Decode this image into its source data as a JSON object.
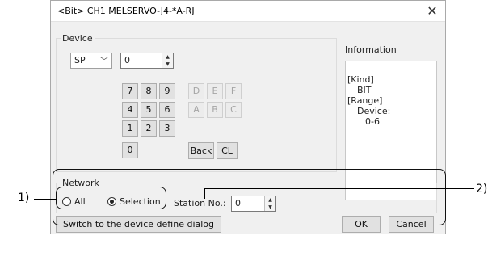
{
  "dialog": {
    "title": "<Bit> CH1 MELSERVO-J4-*A-RJ",
    "close_glyph": "✕"
  },
  "device": {
    "group_label": "Device",
    "type_value": "SP",
    "number_value": "0",
    "keys_row1": [
      "7",
      "8",
      "9",
      "D",
      "E",
      "F"
    ],
    "keys_row2": [
      "4",
      "5",
      "6",
      "A",
      "B",
      "C"
    ],
    "keys_row3": [
      "1",
      "2",
      "3"
    ],
    "key_zero": "0",
    "back_label": "Back",
    "clear_label": "CL"
  },
  "information": {
    "label": "Information",
    "lines": [
      "[Kind]",
      "BIT",
      "[Range]",
      "Device:",
      "0-6"
    ]
  },
  "network": {
    "group_label": "Network",
    "radio_all": "All",
    "radio_selection": "Selection",
    "station_label": "Station No.:",
    "station_value": "0"
  },
  "footer": {
    "switch_label": "Switch to the device define dialog",
    "ok_label": "OK",
    "cancel_label": "Cancel"
  },
  "callouts": {
    "one": "1)",
    "two": "2)"
  }
}
